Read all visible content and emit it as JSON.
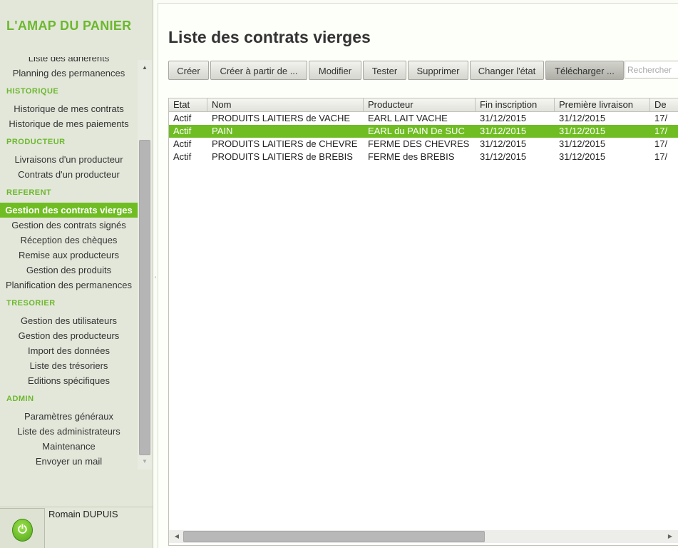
{
  "app": {
    "title": "L'AMAP DU PANIER"
  },
  "sidebar": {
    "menu": [
      {
        "type": "item",
        "label": "Liste des adhérents",
        "name": "menu-liste-adherents"
      },
      {
        "type": "item",
        "label": "Planning des permanences",
        "name": "menu-planning-permanences"
      },
      {
        "type": "head",
        "label": "HISTORIQUE",
        "name": "section-historique"
      },
      {
        "type": "item",
        "label": "Historique de mes contrats",
        "name": "menu-historique-contrats"
      },
      {
        "type": "item",
        "label": "Historique de mes paiements",
        "name": "menu-historique-paiements"
      },
      {
        "type": "head",
        "label": "PRODUCTEUR",
        "name": "section-producteur"
      },
      {
        "type": "item",
        "label": "Livraisons d'un producteur",
        "name": "menu-livraisons-producteur"
      },
      {
        "type": "item",
        "label": "Contrats d'un producteur",
        "name": "menu-contrats-producteur"
      },
      {
        "type": "head",
        "label": "REFERENT",
        "name": "section-referent"
      },
      {
        "type": "item",
        "label": "Gestion des contrats vierges",
        "name": "menu-gestion-contrats-vierges",
        "active": true
      },
      {
        "type": "item",
        "label": "Gestion des contrats signés",
        "name": "menu-gestion-contrats-signes"
      },
      {
        "type": "item",
        "label": "Réception des chèques",
        "name": "menu-reception-cheques"
      },
      {
        "type": "item",
        "label": "Remise aux producteurs",
        "name": "menu-remise-producteurs"
      },
      {
        "type": "item",
        "label": "Gestion des produits",
        "name": "menu-gestion-produits"
      },
      {
        "type": "item",
        "label": "Planification des permanences",
        "name": "menu-planification-permanences"
      },
      {
        "type": "head",
        "label": "TRESORIER",
        "name": "section-tresorier"
      },
      {
        "type": "item",
        "label": "Gestion des utilisateurs",
        "name": "menu-gestion-utilisateurs"
      },
      {
        "type": "item",
        "label": "Gestion des producteurs",
        "name": "menu-gestion-producteurs"
      },
      {
        "type": "item",
        "label": "Import des données",
        "name": "menu-import-donnees"
      },
      {
        "type": "item",
        "label": "Liste des trésoriers",
        "name": "menu-liste-tresoriers"
      },
      {
        "type": "item",
        "label": "Editions spécifiques",
        "name": "menu-editions-specifiques"
      },
      {
        "type": "head",
        "label": "ADMIN",
        "name": "section-admin"
      },
      {
        "type": "item",
        "label": "Paramètres généraux",
        "name": "menu-parametres-generaux"
      },
      {
        "type": "item",
        "label": "Liste des administrateurs",
        "name": "menu-liste-administrateurs"
      },
      {
        "type": "item",
        "label": "Maintenance",
        "name": "menu-maintenance"
      },
      {
        "type": "item",
        "label": "Envoyer un mail",
        "name": "menu-envoyer-mail"
      }
    ],
    "scroll_up_icon": "▲",
    "scroll_down_icon": "▼",
    "splitter_icon": "◦"
  },
  "user": {
    "name": "Romain DUPUIS",
    "power_icon": "⏻"
  },
  "main": {
    "title": "Liste des contrats vierges",
    "toolbar": [
      {
        "label": "Créer",
        "name": "creer-button"
      },
      {
        "label": "Créer à partir de ...",
        "name": "creer-a-partir-de-button"
      },
      {
        "label": "Modifier",
        "name": "modifier-button"
      },
      {
        "label": "Tester",
        "name": "tester-button"
      },
      {
        "label": "Supprimer",
        "name": "supprimer-button"
      },
      {
        "label": "Changer l'état",
        "name": "changer-etat-button"
      },
      {
        "label": "Télécharger ...",
        "name": "telecharger-button",
        "dark": true
      }
    ],
    "search": {
      "placeholder": "Rechercher"
    },
    "table": {
      "columns": [
        "Etat",
        "Nom",
        "Producteur",
        "Fin inscription",
        "Première livraison",
        "De"
      ],
      "rows": [
        {
          "cells": [
            "Actif",
            "PRODUITS LAITIERS de VACHE",
            "EARL LAIT VACHE",
            "31/12/2015",
            "31/12/2015",
            "17/"
          ]
        },
        {
          "cells": [
            "Actif",
            "PAIN",
            "EARL du PAIN De SUC",
            "31/12/2015",
            "31/12/2015",
            "17/"
          ],
          "selected": true
        },
        {
          "cells": [
            "Actif",
            "PRODUITS LAITIERS de CHEVRE",
            "FERME DES CHEVRES",
            "31/12/2015",
            "31/12/2015",
            "17/"
          ]
        },
        {
          "cells": [
            "Actif",
            "PRODUITS LAITIERS de BREBIS",
            "FERME des BREBIS",
            "31/12/2015",
            "31/12/2015",
            "17/"
          ]
        }
      ]
    },
    "hscroll": {
      "left_icon": "◀",
      "right_icon": "▶"
    }
  }
}
